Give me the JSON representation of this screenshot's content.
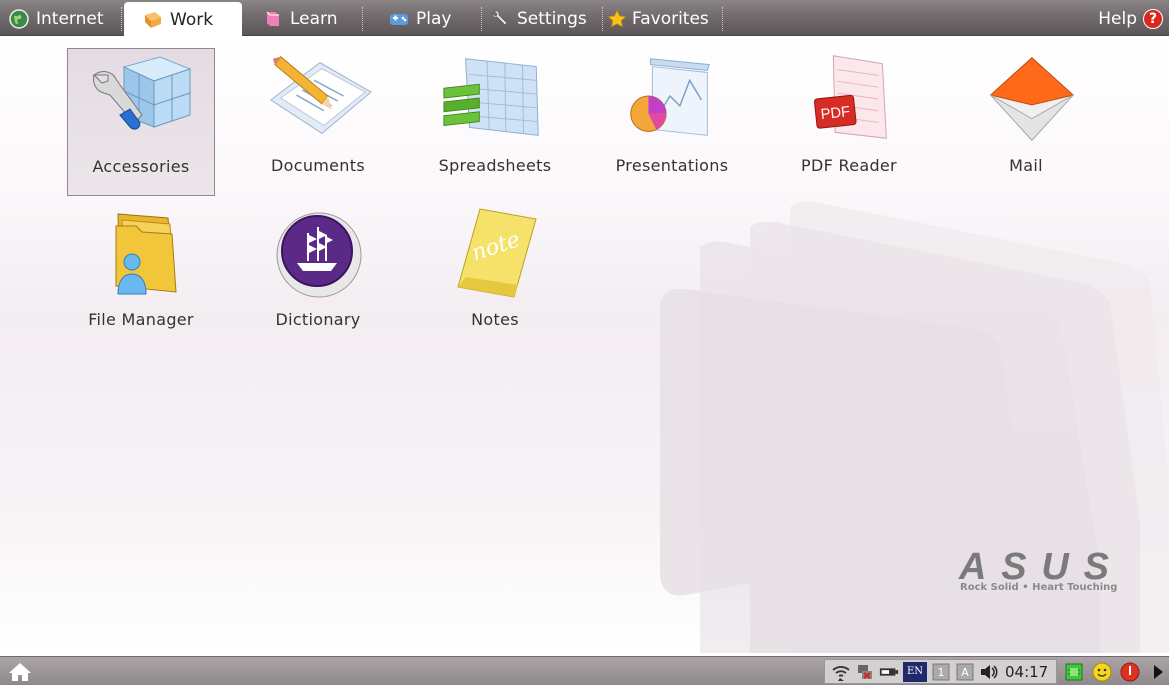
{
  "tabs": [
    {
      "label": "Internet",
      "icon": "globe-icon"
    },
    {
      "label": "Work",
      "icon": "briefcase-icon",
      "active": true
    },
    {
      "label": "Learn",
      "icon": "book-icon"
    },
    {
      "label": "Play",
      "icon": "gamepad-icon"
    },
    {
      "label": "Settings",
      "icon": "wrench-icon"
    },
    {
      "label": "Favorites",
      "icon": "star-icon"
    }
  ],
  "help": {
    "label": "Help",
    "badge": "?"
  },
  "apps": [
    {
      "label": "Accessories",
      "icon": "accessories-icon",
      "selected": true
    },
    {
      "label": "Documents",
      "icon": "documents-icon"
    },
    {
      "label": "Spreadsheets",
      "icon": "spreadsheets-icon"
    },
    {
      "label": "Presentations",
      "icon": "presentations-icon"
    },
    {
      "label": "PDF Reader",
      "icon": "pdf-reader-icon",
      "icon_text": "PDF"
    },
    {
      "label": "Mail",
      "icon": "mail-icon"
    },
    {
      "label": "File Manager",
      "icon": "file-manager-icon"
    },
    {
      "label": "Dictionary",
      "icon": "dictionary-icon"
    },
    {
      "label": "Notes",
      "icon": "notes-icon",
      "icon_text": "note"
    }
  ],
  "brand": {
    "logo": "ASUS",
    "tagline": "Rock Solid • Heart Touching"
  },
  "taskbar": {
    "language": "EN",
    "clock": "04:17",
    "tray_icons": [
      "wifi-icon",
      "network-off-icon",
      "battery-icon",
      "keyboard-1-icon",
      "keyboard-a-icon",
      "volume-icon"
    ],
    "tray_icons_right": [
      "chip-icon",
      "smiley-icon",
      "power-icon",
      "arrow-right-icon"
    ]
  },
  "colors": {
    "accent_red": "#d6281e",
    "tab_bar": "#6e6769",
    "tray_lang_bg": "#202a6b"
  }
}
